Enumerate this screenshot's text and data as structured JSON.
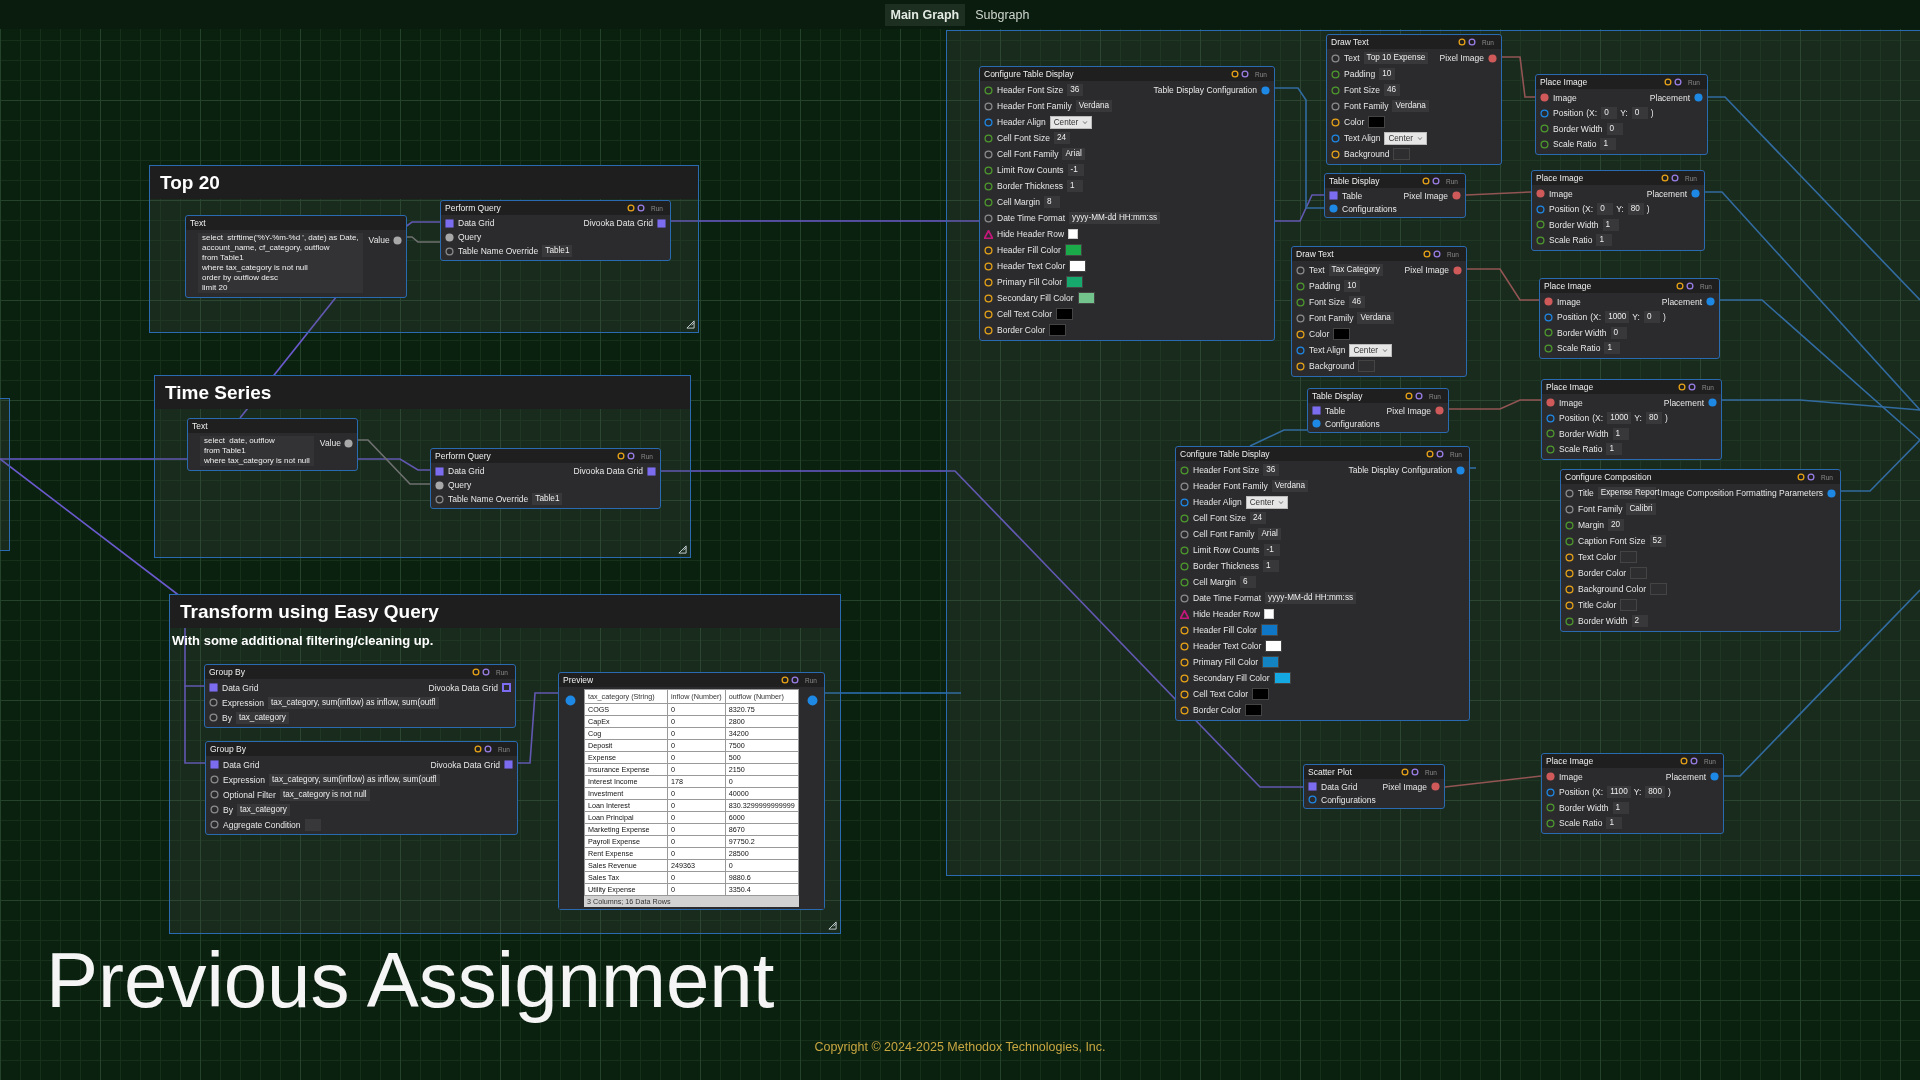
{
  "tabs": [
    {
      "label": "Main Graph",
      "selected": true
    },
    {
      "label": "Subgraph",
      "selected": false
    }
  ],
  "frames": [
    {
      "title": "Top 20"
    },
    {
      "title": "Time Series"
    },
    {
      "title": "Transform using Easy Query",
      "subtitle": "With some additional filtering/cleaning up."
    }
  ],
  "nodes": [
    {
      "kind": "text",
      "title": "Text",
      "lines": [
        "select  strftime('%Y-%m-%d ', date) as Date,",
        "account_name, cf_category, outflow",
        "from Table1",
        "where tax_category is not null",
        "order by outflow desc",
        "limit 20"
      ],
      "outputs": [
        {
          "label": "Value",
          "port": {
            "kind": "dot",
            "color": "#a8a8a8"
          }
        }
      ]
    },
    {
      "kind": "standard",
      "title": "Perform Query",
      "run": "Run",
      "inputs": [
        {
          "label": "Data Grid",
          "port": {
            "kind": "square",
            "color": "#7b6cf0"
          }
        },
        {
          "label": "Query",
          "port": {
            "kind": "dot",
            "color": "#a8a8a8"
          }
        },
        {
          "label": "Table Name Override",
          "port": {
            "kind": "ring",
            "color": "#8c8c8c"
          },
          "field": {
            "kind": "text",
            "value": "Table1"
          }
        }
      ],
      "outputs": [
        {
          "label": "Divooka Data Grid",
          "port": {
            "kind": "square",
            "color": "#7b6cf0"
          }
        }
      ]
    },
    {
      "kind": "text",
      "title": "Text",
      "lines": [
        "select  date, outflow",
        "from Table1",
        "where tax_category is not null"
      ],
      "outputs": [
        {
          "label": "Value",
          "port": {
            "kind": "dot",
            "color": "#a8a8a8"
          }
        }
      ]
    },
    {
      "kind": "standard",
      "title": "Perform Query",
      "run": "Run",
      "inputs": [
        {
          "label": "Data Grid",
          "port": {
            "kind": "square",
            "color": "#7b6cf0"
          }
        },
        {
          "label": "Query",
          "port": {
            "kind": "dot",
            "color": "#a8a8a8"
          }
        },
        {
          "label": "Table Name Override",
          "port": {
            "kind": "ring",
            "color": "#8c8c8c"
          },
          "field": {
            "kind": "text",
            "value": "Table1"
          }
        }
      ],
      "outputs": [
        {
          "label": "Divooka Data Grid",
          "port": {
            "kind": "square",
            "color": "#7b6cf0"
          }
        }
      ]
    },
    {
      "kind": "standard",
      "title": "Group By",
      "run": "Run",
      "inputs": [
        {
          "label": "Data Grid",
          "port": {
            "kind": "square",
            "color": "#7b6cf0"
          }
        },
        {
          "label": "Expression",
          "port": {
            "kind": "ring",
            "color": "#8c8c8c"
          },
          "field": {
            "kind": "text",
            "value": "tax_category, sum(inflow) as inflow, sum(outfl"
          }
        },
        {
          "label": "By",
          "port": {
            "kind": "ring",
            "color": "#8c8c8c"
          },
          "field": {
            "kind": "text",
            "value": "tax_category"
          }
        }
      ],
      "outputs": [
        {
          "label": "Divooka Data Grid",
          "port": {
            "kind": "hollow-square",
            "color": "#7b6cf0"
          }
        }
      ]
    },
    {
      "kind": "standard",
      "title": "Group By",
      "run": "Run",
      "inputs": [
        {
          "label": "Data Grid",
          "port": {
            "kind": "square",
            "color": "#7b6cf0"
          }
        },
        {
          "label": "Expression",
          "port": {
            "kind": "ring",
            "color": "#8c8c8c"
          },
          "field": {
            "kind": "text",
            "value": "tax_category, sum(inflow) as inflow, sum(outfl"
          }
        },
        {
          "label": "Optional Filter",
          "port": {
            "kind": "ring",
            "color": "#8c8c8c"
          },
          "field": {
            "kind": "text",
            "value": "tax_category is not null"
          }
        },
        {
          "label": "By",
          "port": {
            "kind": "ring",
            "color": "#8c8c8c"
          },
          "field": {
            "kind": "text",
            "value": "tax_category"
          }
        },
        {
          "label": "Aggregate Condition",
          "port": {
            "kind": "ring",
            "color": "#8c8c8c"
          },
          "field": {
            "kind": "text"
          }
        }
      ],
      "outputs": [
        {
          "label": "Divooka Data Grid",
          "port": {
            "kind": "square",
            "color": "#7b6cf0"
          }
        }
      ]
    },
    {
      "kind": "preview",
      "title": "Preview",
      "run": "Run",
      "inputs": [
        {
          "port": {
            "kind": "dot",
            "color": "#1e88e5"
          }
        }
      ],
      "outputs": [
        {
          "port": {
            "kind": "dot",
            "color": "#1e88e5"
          }
        }
      ],
      "table": {
        "columns": [
          "tax_category (String)",
          "inflow (Number)",
          "outflow (Number)"
        ],
        "rows": [
          [
            "COGS",
            "0",
            "8320.75"
          ],
          [
            "CapEx",
            "0",
            "2800"
          ],
          [
            "Cog",
            "0",
            "34200"
          ],
          [
            "Deposit",
            "0",
            "7500"
          ],
          [
            "Expense",
            "0",
            "500"
          ],
          [
            "Insurance Expense",
            "0",
            "2150"
          ],
          [
            "Interest Income",
            "178",
            "0"
          ],
          [
            "Investment",
            "0",
            "40000"
          ],
          [
            "Loan Interest",
            "0",
            "830.3299999999999"
          ],
          [
            "Loan Principal",
            "0",
            "6000"
          ],
          [
            "Marketing Expense",
            "0",
            "8670"
          ],
          [
            "Payroll Expense",
            "0",
            "97750.2"
          ],
          [
            "Rent Expense",
            "0",
            "28500"
          ],
          [
            "Sales Revenue",
            "249363",
            "0"
          ],
          [
            "Sales Tax",
            "0",
            "9880.6"
          ],
          [
            "Utility Expense",
            "0",
            "3350.4"
          ]
        ],
        "footer": "3 Columns; 16  Data Rows"
      }
    },
    {
      "kind": "standard",
      "title": "Configure Table Display",
      "run": "Run",
      "inputs": [
        {
          "label": "Header Font Size",
          "port": {
            "kind": "ring",
            "color": "#4e9a2c"
          },
          "field": {
            "kind": "text",
            "value": "36"
          }
        },
        {
          "label": "Header Font Family",
          "port": {
            "kind": "ring",
            "color": "#8c8c8c"
          },
          "field": {
            "kind": "text",
            "value": "Verdana"
          }
        },
        {
          "label": "Header Align",
          "port": {
            "kind": "ring",
            "color": "#1e88e5"
          },
          "field": {
            "kind": "select",
            "value": "Center"
          }
        },
        {
          "label": "Cell Font Size",
          "port": {
            "kind": "ring",
            "color": "#4e9a2c"
          },
          "field": {
            "kind": "text",
            "value": "24"
          }
        },
        {
          "label": "Cell Font Family",
          "port": {
            "kind": "ring",
            "color": "#8c8c8c"
          },
          "field": {
            "kind": "text",
            "value": "Arial"
          }
        },
        {
          "label": "Limit Row Counts",
          "port": {
            "kind": "ring",
            "color": "#4e9a2c"
          },
          "field": {
            "kind": "text",
            "value": "-1"
          }
        },
        {
          "label": "Border Thickness",
          "port": {
            "kind": "ring",
            "color": "#4e9a2c"
          },
          "field": {
            "kind": "text",
            "value": "1"
          }
        },
        {
          "label": "Cell Margin",
          "port": {
            "kind": "ring",
            "color": "#4e9a2c"
          },
          "field": {
            "kind": "text",
            "value": "8"
          }
        },
        {
          "label": "Date Time Format",
          "port": {
            "kind": "ring",
            "color": "#8c8c8c"
          },
          "field": {
            "kind": "text",
            "value": "yyyy-MM-dd HH:mm:ss"
          }
        },
        {
          "label": "Hide Header Row",
          "port": {
            "kind": "triangle",
            "color": "#c2187a"
          },
          "field": {
            "kind": "checkbox",
            "checked": false
          }
        },
        {
          "label": "Header Fill Color",
          "port": {
            "kind": "ring",
            "color": "#e8a317"
          },
          "field": {
            "kind": "swatch",
            "color": "#1aaa4a"
          }
        },
        {
          "label": "Header Text Color",
          "port": {
            "kind": "ring",
            "color": "#e8a317"
          },
          "field": {
            "kind": "swatch",
            "color": "#ffffff"
          }
        },
        {
          "label": "Primary Fill Color",
          "port": {
            "kind": "ring",
            "color": "#e8a317"
          },
          "field": {
            "kind": "swatch",
            "color": "#17a86e"
          }
        },
        {
          "label": "Secondary Fill Color",
          "port": {
            "kind": "ring",
            "color": "#e8a317"
          },
          "field": {
            "kind": "swatch",
            "color": "#72c48c"
          }
        },
        {
          "label": "Cell Text Color",
          "port": {
            "kind": "ring",
            "color": "#e8a317"
          },
          "field": {
            "kind": "swatch",
            "color": "#000000"
          }
        },
        {
          "label": "Border Color",
          "port": {
            "kind": "ring",
            "color": "#e8a317"
          },
          "field": {
            "kind": "swatch",
            "color": "#000000"
          }
        }
      ],
      "outputs": [
        {
          "label": "Table Display Configuration",
          "port": {
            "kind": "dot",
            "color": "#1e88e5"
          }
        }
      ]
    },
    {
      "kind": "standard",
      "title": "Draw Text",
      "run": "Run",
      "inputs": [
        {
          "label": "Text",
          "port": {
            "kind": "ring",
            "color": "#8c8c8c"
          },
          "field": {
            "kind": "text",
            "value": "Top 10 Expense"
          }
        },
        {
          "label": "Padding",
          "port": {
            "kind": "ring",
            "color": "#4e9a2c"
          },
          "field": {
            "kind": "text",
            "value": "10"
          }
        },
        {
          "label": "Font Size",
          "port": {
            "kind": "ring",
            "color": "#4e9a2c"
          },
          "field": {
            "kind": "text",
            "value": "46"
          }
        },
        {
          "label": "Font Family",
          "port": {
            "kind": "ring",
            "color": "#8c8c8c"
          },
          "field": {
            "kind": "text",
            "value": "Verdana"
          }
        },
        {
          "label": "Color",
          "port": {
            "kind": "ring",
            "color": "#e8a317"
          },
          "field": {
            "kind": "swatch",
            "color": "#000000"
          }
        },
        {
          "label": "Text Align",
          "port": {
            "kind": "ring",
            "color": "#1e88e5"
          },
          "field": {
            "kind": "select",
            "value": "Center"
          }
        },
        {
          "label": "Background",
          "port": {
            "kind": "ring",
            "color": "#e8a317"
          },
          "field": {
            "kind": "swatch"
          }
        }
      ],
      "outputs": [
        {
          "label": "Pixel Image",
          "port": {
            "kind": "dot",
            "color": "#d05a5a"
          }
        }
      ]
    },
    {
      "kind": "standard",
      "title": "Table Display",
      "run": "Run",
      "inputs": [
        {
          "label": "Table",
          "port": {
            "kind": "square",
            "color": "#7b6cf0"
          }
        },
        {
          "label": "Configurations",
          "port": {
            "kind": "dot",
            "color": "#1e88e5"
          }
        }
      ],
      "outputs": [
        {
          "label": "Pixel Image",
          "port": {
            "kind": "dot",
            "color": "#d05a5a"
          }
        }
      ]
    },
    {
      "kind": "standard",
      "title": "Draw Text",
      "run": "Run",
      "inputs": [
        {
          "label": "Text",
          "port": {
            "kind": "ring",
            "color": "#8c8c8c"
          },
          "field": {
            "kind": "text",
            "value": "Tax Category"
          }
        },
        {
          "label": "Padding",
          "port": {
            "kind": "ring",
            "color": "#4e9a2c"
          },
          "field": {
            "kind": "text",
            "value": "10"
          }
        },
        {
          "label": "Font Size",
          "port": {
            "kind": "ring",
            "color": "#4e9a2c"
          },
          "field": {
            "kind": "text",
            "value": "46"
          }
        },
        {
          "label": "Font Family",
          "port": {
            "kind": "ring",
            "color": "#8c8c8c"
          },
          "field": {
            "kind": "text",
            "value": "Verdana"
          }
        },
        {
          "label": "Color",
          "port": {
            "kind": "ring",
            "color": "#e8a317"
          },
          "field": {
            "kind": "swatch",
            "color": "#000000"
          }
        },
        {
          "label": "Text Align",
          "port": {
            "kind": "ring",
            "color": "#1e88e5"
          },
          "field": {
            "kind": "select",
            "value": "Center"
          }
        },
        {
          "label": "Background",
          "port": {
            "kind": "ring",
            "color": "#e8a317"
          },
          "field": {
            "kind": "swatch"
          }
        }
      ],
      "outputs": [
        {
          "label": "Pixel Image",
          "port": {
            "kind": "dot",
            "color": "#d05a5a"
          }
        }
      ]
    },
    {
      "kind": "standard",
      "title": "Table Display",
      "run": "Run",
      "inputs": [
        {
          "label": "Table",
          "port": {
            "kind": "square",
            "color": "#7b6cf0"
          }
        },
        {
          "label": "Configurations",
          "port": {
            "kind": "dot",
            "color": "#1e88e5"
          }
        }
      ],
      "outputs": [
        {
          "label": "Pixel Image",
          "port": {
            "kind": "dot",
            "color": "#d05a5a"
          }
        }
      ]
    },
    {
      "kind": "standard",
      "title": "Configure Table Display",
      "run": "Run",
      "inputs": [
        {
          "label": "Header Font Size",
          "port": {
            "kind": "ring",
            "color": "#4e9a2c"
          },
          "field": {
            "kind": "text",
            "value": "36"
          }
        },
        {
          "label": "Header Font Family",
          "port": {
            "kind": "ring",
            "color": "#8c8c8c"
          },
          "field": {
            "kind": "text",
            "value": "Verdana"
          }
        },
        {
          "label": "Header Align",
          "port": {
            "kind": "ring",
            "color": "#1e88e5"
          },
          "field": {
            "kind": "select",
            "value": "Center"
          }
        },
        {
          "label": "Cell Font Size",
          "port": {
            "kind": "ring",
            "color": "#4e9a2c"
          },
          "field": {
            "kind": "text",
            "value": "24"
          }
        },
        {
          "label": "Cell Font Family",
          "port": {
            "kind": "ring",
            "color": "#8c8c8c"
          },
          "field": {
            "kind": "text",
            "value": "Arial"
          }
        },
        {
          "label": "Limit Row Counts",
          "port": {
            "kind": "ring",
            "color": "#4e9a2c"
          },
          "field": {
            "kind": "text",
            "value": "-1"
          }
        },
        {
          "label": "Border Thickness",
          "port": {
            "kind": "ring",
            "color": "#4e9a2c"
          },
          "field": {
            "kind": "text",
            "value": "1"
          }
        },
        {
          "label": "Cell Margin",
          "port": {
            "kind": "ring",
            "color": "#4e9a2c"
          },
          "field": {
            "kind": "text",
            "value": "6"
          }
        },
        {
          "label": "Date Time Format",
          "port": {
            "kind": "ring",
            "color": "#8c8c8c"
          },
          "field": {
            "kind": "text",
            "value": "yyyy-MM-dd HH:mm:ss"
          }
        },
        {
          "label": "Hide Header Row",
          "port": {
            "kind": "triangle",
            "color": "#c2187a"
          },
          "field": {
            "kind": "checkbox",
            "checked": false
          }
        },
        {
          "label": "Header Fill Color",
          "port": {
            "kind": "ring",
            "color": "#e8a317"
          },
          "field": {
            "kind": "swatch",
            "color": "#0e76c4"
          }
        },
        {
          "label": "Header Text Color",
          "port": {
            "kind": "ring",
            "color": "#e8a317"
          },
          "field": {
            "kind": "swatch",
            "color": "#ffffff"
          }
        },
        {
          "label": "Primary Fill Color",
          "port": {
            "kind": "ring",
            "color": "#e8a317"
          },
          "field": {
            "kind": "swatch",
            "color": "#1483c2"
          }
        },
        {
          "label": "Secondary Fill Color",
          "port": {
            "kind": "ring",
            "color": "#e8a317"
          },
          "field": {
            "kind": "swatch",
            "color": "#14a9e2"
          }
        },
        {
          "label": "Cell Text Color",
          "port": {
            "kind": "ring",
            "color": "#e8a317"
          },
          "field": {
            "kind": "swatch",
            "color": "#000000"
          }
        },
        {
          "label": "Border Color",
          "port": {
            "kind": "ring",
            "color": "#e8a317"
          },
          "field": {
            "kind": "swatch",
            "color": "#000000"
          }
        }
      ],
      "outputs": [
        {
          "label": "Table Display Configuration",
          "port": {
            "kind": "dot",
            "color": "#1e88e5"
          }
        }
      ]
    },
    {
      "kind": "standard",
      "title": "Scatter Plot",
      "run": "Run",
      "inputs": [
        {
          "label": "Data Grid",
          "port": {
            "kind": "square",
            "color": "#7b6cf0"
          }
        },
        {
          "label": "Configurations",
          "port": {
            "kind": "ring",
            "color": "#1e88e5"
          }
        }
      ],
      "outputs": [
        {
          "label": "Pixel Image",
          "port": {
            "kind": "dot",
            "color": "#d05a5a"
          }
        }
      ]
    },
    {
      "kind": "standard",
      "title": "Place Image",
      "run": "Run",
      "inputs": [
        {
          "label": "Image",
          "port": {
            "kind": "dot",
            "color": "#d05a5a"
          }
        },
        {
          "label": "Position",
          "port": {
            "kind": "ring",
            "color": "#1e88e5"
          },
          "field": {
            "kind": "position",
            "coords": [
              {
                "prefix": "(X:",
                "value": "0"
              },
              {
                "prefix": "Y:",
                "value": "0"
              }
            ],
            "suffix": ")"
          }
        },
        {
          "label": "Border Width",
          "port": {
            "kind": "ring",
            "color": "#4e9a2c"
          },
          "field": {
            "kind": "text",
            "value": "0"
          }
        },
        {
          "label": "Scale Ratio",
          "port": {
            "kind": "ring",
            "color": "#4e9a2c"
          },
          "field": {
            "kind": "text",
            "value": "1"
          }
        }
      ],
      "outputs": [
        {
          "label": "Placement",
          "port": {
            "kind": "dot",
            "color": "#1e88e5"
          }
        }
      ]
    },
    {
      "kind": "standard",
      "title": "Place Image",
      "run": "Run",
      "inputs": [
        {
          "label": "Image",
          "port": {
            "kind": "dot",
            "color": "#d05a5a"
          }
        },
        {
          "label": "Position",
          "port": {
            "kind": "ring",
            "color": "#1e88e5"
          },
          "field": {
            "kind": "position",
            "coords": [
              {
                "prefix": "(X:",
                "value": "0"
              },
              {
                "prefix": "Y:",
                "value": "80"
              }
            ],
            "suffix": ")"
          }
        },
        {
          "label": "Border Width",
          "port": {
            "kind": "ring",
            "color": "#4e9a2c"
          },
          "field": {
            "kind": "text",
            "value": "1"
          }
        },
        {
          "label": "Scale Ratio",
          "port": {
            "kind": "ring",
            "color": "#4e9a2c"
          },
          "field": {
            "kind": "text",
            "value": "1"
          }
        }
      ],
      "outputs": [
        {
          "label": "Placement",
          "port": {
            "kind": "dot",
            "color": "#1e88e5"
          }
        }
      ]
    },
    {
      "kind": "standard",
      "title": "Place Image",
      "run": "Run",
      "inputs": [
        {
          "label": "Image",
          "port": {
            "kind": "dot",
            "color": "#d05a5a"
          }
        },
        {
          "label": "Position",
          "port": {
            "kind": "ring",
            "color": "#1e88e5"
          },
          "field": {
            "kind": "position",
            "coords": [
              {
                "prefix": "(X:",
                "value": "1000"
              },
              {
                "prefix": "Y:",
                "value": "0"
              }
            ],
            "suffix": ")"
          }
        },
        {
          "label": "Border Width",
          "port": {
            "kind": "ring",
            "color": "#4e9a2c"
          },
          "field": {
            "kind": "text",
            "value": "0"
          }
        },
        {
          "label": "Scale Ratio",
          "port": {
            "kind": "ring",
            "color": "#4e9a2c"
          },
          "field": {
            "kind": "text",
            "value": "1"
          }
        }
      ],
      "outputs": [
        {
          "label": "Placement",
          "port": {
            "kind": "dot",
            "color": "#1e88e5"
          }
        }
      ]
    },
    {
      "kind": "standard",
      "title": "Place Image",
      "run": "Run",
      "inputs": [
        {
          "label": "Image",
          "port": {
            "kind": "dot",
            "color": "#d05a5a"
          }
        },
        {
          "label": "Position",
          "port": {
            "kind": "ring",
            "color": "#1e88e5"
          },
          "field": {
            "kind": "position",
            "coords": [
              {
                "prefix": "(X:",
                "value": "1000"
              },
              {
                "prefix": "Y:",
                "value": "80"
              }
            ],
            "suffix": ")"
          }
        },
        {
          "label": "Border Width",
          "port": {
            "kind": "ring",
            "color": "#4e9a2c"
          },
          "field": {
            "kind": "text",
            "value": "1"
          }
        },
        {
          "label": "Scale Ratio",
          "port": {
            "kind": "ring",
            "color": "#4e9a2c"
          },
          "field": {
            "kind": "text",
            "value": "1"
          }
        }
      ],
      "outputs": [
        {
          "label": "Placement",
          "port": {
            "kind": "dot",
            "color": "#1e88e5"
          }
        }
      ]
    },
    {
      "kind": "standard",
      "title": "Configure Composition",
      "run": "Run",
      "inputs": [
        {
          "label": "Title",
          "port": {
            "kind": "ring",
            "color": "#8c8c8c"
          },
          "field": {
            "kind": "text",
            "value": "Expense Report"
          }
        },
        {
          "label": "Font Family",
          "port": {
            "kind": "ring",
            "color": "#8c8c8c"
          },
          "field": {
            "kind": "text",
            "value": "Calibri"
          }
        },
        {
          "label": "Margin",
          "port": {
            "kind": "ring",
            "color": "#4e9a2c"
          },
          "field": {
            "kind": "text",
            "value": "20"
          }
        },
        {
          "label": "Caption Font Size",
          "port": {
            "kind": "ring",
            "color": "#4e9a2c"
          },
          "field": {
            "kind": "text",
            "value": "52"
          }
        },
        {
          "label": "Text Color",
          "port": {
            "kind": "ring",
            "color": "#e8a317"
          },
          "field": {
            "kind": "swatch"
          }
        },
        {
          "label": "Border Color",
          "port": {
            "kind": "ring",
            "color": "#e8a317"
          },
          "field": {
            "kind": "swatch"
          }
        },
        {
          "label": "Background Color",
          "port": {
            "kind": "ring",
            "color": "#e8a317"
          },
          "field": {
            "kind": "swatch"
          }
        },
        {
          "label": "Title Color",
          "port": {
            "kind": "ring",
            "color": "#e8a317"
          },
          "field": {
            "kind": "swatch"
          }
        },
        {
          "label": "Border Width",
          "port": {
            "kind": "ring",
            "color": "#4e9a2c"
          },
          "field": {
            "kind": "text",
            "value": "2"
          }
        }
      ],
      "outputs": [
        {
          "label": "Image Composition Formatting Parameters",
          "port": {
            "kind": "dot",
            "color": "#1e88e5"
          }
        }
      ]
    },
    {
      "kind": "standard",
      "title": "Place Image",
      "run": "Run",
      "inputs": [
        {
          "label": "Image",
          "port": {
            "kind": "dot",
            "color": "#d05a5a"
          }
        },
        {
          "label": "Position",
          "port": {
            "kind": "ring",
            "color": "#1e88e5"
          },
          "field": {
            "kind": "position",
            "coords": [
              {
                "prefix": "(X:",
                "value": "1100"
              },
              {
                "prefix": "Y:",
                "value": "800"
              }
            ],
            "suffix": ")"
          }
        },
        {
          "label": "Border Width",
          "port": {
            "kind": "ring",
            "color": "#4e9a2c"
          },
          "field": {
            "kind": "text",
            "value": "1"
          }
        },
        {
          "label": "Scale Ratio",
          "port": {
            "kind": "ring",
            "color": "#4e9a2c"
          },
          "field": {
            "kind": "text",
            "value": "1"
          }
        }
      ],
      "outputs": [
        {
          "label": "Placement",
          "port": {
            "kind": "dot",
            "color": "#1e88e5"
          }
        }
      ]
    }
  ],
  "caption": "Previous Assignment",
  "copyright": "Copyright © 2024-2025 Methodox Technologies, Inc."
}
